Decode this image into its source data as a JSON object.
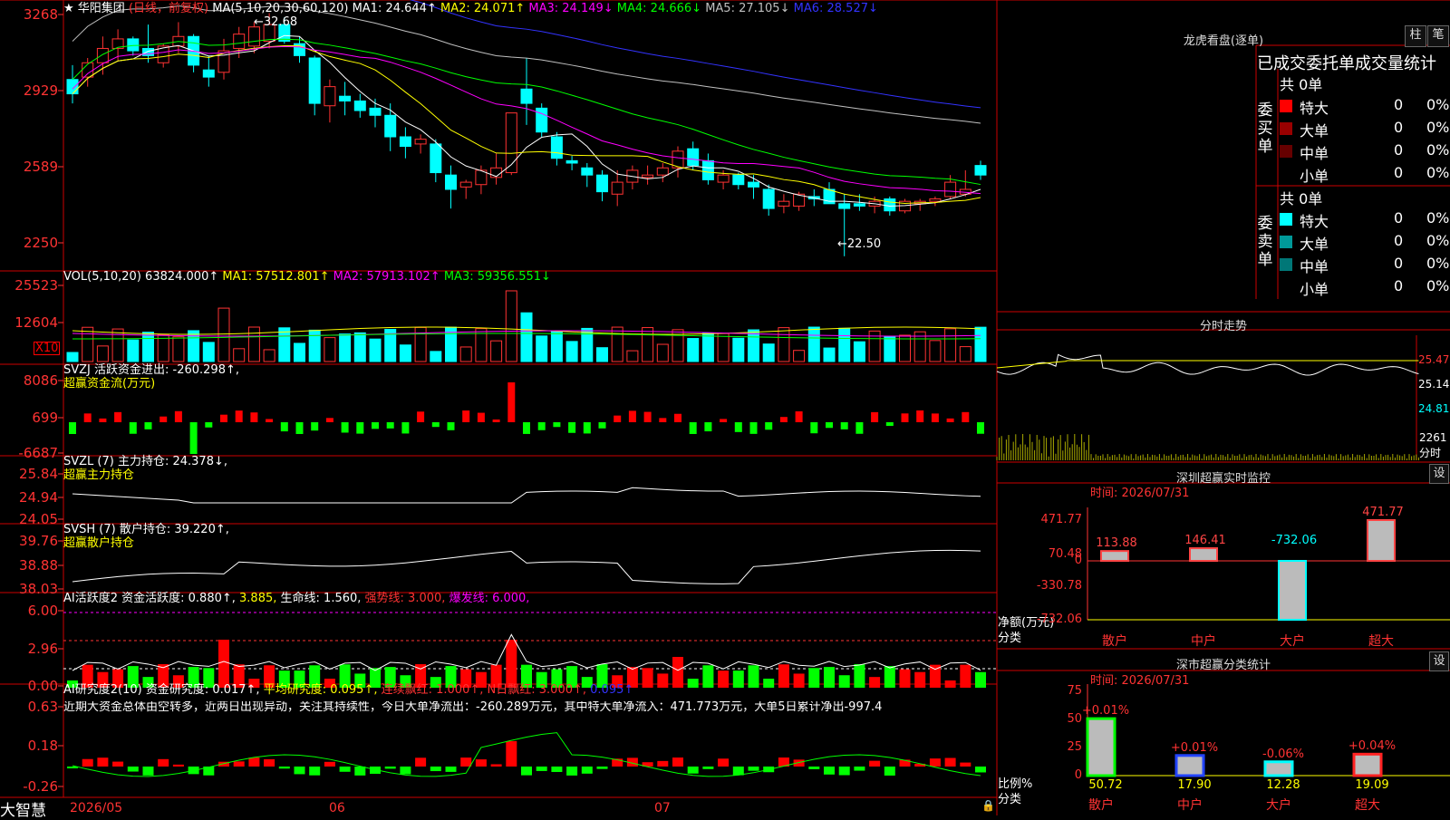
{
  "stock": {
    "name": "华阳集团",
    "mode": "(日线，前复权)",
    "star": "★"
  },
  "main_legend": {
    "ma_params": "MA(5,10,20,30,60,120)",
    "items": [
      {
        "label": "MA1: 24.644↑",
        "color": "#ffffff"
      },
      {
        "label": "MA2: 24.071↑",
        "color": "#ffff00"
      },
      {
        "label": "MA3: 24.149↓",
        "color": "#ff00ff"
      },
      {
        "label": "MA4: 24.666↓",
        "color": "#00ff00"
      },
      {
        "label": "MA5: 27.105↓",
        "color": "#c0c0c0"
      },
      {
        "label": "MA6: 28.527↓",
        "color": "#3333ff"
      }
    ]
  },
  "price_axis": [
    "3268",
    "2929",
    "2589",
    "2250"
  ],
  "price_annotations": {
    "high": "←32.68",
    "low": "←22.50"
  },
  "vol_panel": {
    "title": "VOL(5,10,20)",
    "value": "63824.000↑",
    "items": [
      {
        "label": "MA1: 57512.801↑",
        "color": "#ffff00"
      },
      {
        "label": "MA2: 57913.102↑",
        "color": "#ff00ff"
      },
      {
        "label": "MA3: 59356.551↓",
        "color": "#00ff00"
      }
    ],
    "axis": [
      "25523",
      "12604"
    ],
    "unit": "X10"
  },
  "svzj_panel": {
    "title": "SVZJ  活跃资金进出: -260.298↑,",
    "subtitle": "超赢资金流(万元)",
    "axis": [
      "8086",
      "699",
      "-6687"
    ]
  },
  "svzl_panel": {
    "title": "SVZL (7) 主力持仓: 24.378↓,",
    "subtitle": "超赢主力持仓",
    "axis": [
      "25.84",
      "24.94",
      "24.05"
    ]
  },
  "svsh_panel": {
    "title": "SVSH (7) 散户持仓: 39.220↑,",
    "subtitle": "超赢散户持仓",
    "axis": [
      "39.76",
      "38.88",
      "38.03"
    ]
  },
  "ai_active_panel": {
    "title_a": "AI活跃度2 资金活跃度: 0.880↑,",
    "title_b": "3.885,",
    "title_c": "生命线: 1.560,",
    "title_d": "强势线: 3.000,",
    "title_e": "爆发线: 6.000,",
    "axis": [
      "6.00",
      "2.96",
      "0.00"
    ]
  },
  "ai_research_panel": {
    "title_a": "AI研究度2(10) 资金研究度: 0.017↑,",
    "title_b": "平均研究度: 0.095↑,",
    "title_c": "连续飘红: 1.000↑,",
    "title_d": "N日飘红: 3.000↑,",
    "title_e": "0.095↑",
    "comment": "近期大资金总体由空转多，近两日出现异动，关注其持续性，今日大单净流出：-260.289万元，其中特大单净流入：471.773万元，大单5日累计净出-997.4",
    "axis": [
      "0.63",
      "0.18",
      "-0.26"
    ]
  },
  "date_axis": {
    "labels": [
      "2026/05",
      "06",
      "07"
    ],
    "brand": "大智慧"
  },
  "right_top": {
    "title": "龙虎看盘(逐单)",
    "btn_a": "柱",
    "btn_b": "笔",
    "tabs": "已成交委托单成交量统计",
    "buy": {
      "side": "委买单",
      "total": "共 0单",
      "rows": [
        {
          "label": "特大",
          "count": "0",
          "pct": "0%",
          "color": "#ff0000"
        },
        {
          "label": "大单",
          "count": "0",
          "pct": "0%",
          "color": "#990000"
        },
        {
          "label": "中单",
          "count": "0",
          "pct": "0%",
          "color": "#660000"
        },
        {
          "label": "小单",
          "count": "0",
          "pct": "0%",
          "color": "#000000"
        }
      ]
    },
    "sell": {
      "side": "委卖单",
      "total": "共 0单",
      "rows": [
        {
          "label": "特大",
          "count": "0",
          "pct": "0%",
          "color": "#00ffff"
        },
        {
          "label": "大单",
          "count": "0",
          "pct": "0%",
          "color": "#009999"
        },
        {
          "label": "中单",
          "count": "0",
          "pct": "0%",
          "color": "#007777"
        },
        {
          "label": "小单",
          "count": "0",
          "pct": "0%",
          "color": "#000000"
        }
      ]
    }
  },
  "intraday": {
    "title": "分时走势",
    "axis": [
      "25.47",
      "25.14",
      "24.81"
    ],
    "vol_label": "2261",
    "unit": "分时"
  },
  "monitor": {
    "title": "深圳超赢实时监控",
    "btn": "设",
    "time": "时间: 2026/07/31",
    "axis": [
      "471.77",
      "70.48",
      "0",
      "-330.78",
      "-732.06"
    ],
    "ylabel": "净额(万元)",
    "xlabel": "分类",
    "bars": [
      {
        "cat": "散户",
        "value": 113.88,
        "label": "113.88"
      },
      {
        "cat": "中户",
        "value": 146.41,
        "label": "146.41"
      },
      {
        "cat": "大户",
        "value": -732.06,
        "label": "-732.06"
      },
      {
        "cat": "超大",
        "value": 471.77,
        "label": "471.77"
      }
    ]
  },
  "classify": {
    "title": "深市超赢分类统计",
    "btn": "设",
    "time": "时间: 2026/07/31",
    "axis": [
      "75",
      "50",
      "25",
      "0"
    ],
    "ylabel": "比例%",
    "xlabel": "分类",
    "bars": [
      {
        "cat": "散户",
        "value": 50.72,
        "label": "50.72",
        "delta": "+0.01%",
        "color": "#00ff00"
      },
      {
        "cat": "中户",
        "value": 17.9,
        "label": "17.90",
        "delta": "+0.01%",
        "color": "#2244ff"
      },
      {
        "cat": "大户",
        "value": 12.28,
        "label": "12.28",
        "delta": "-0.06%",
        "color": "#00ffff"
      },
      {
        "cat": "超大",
        "value": 19.09,
        "label": "19.09",
        "delta": "+0.04%",
        "color": "#ff2222"
      }
    ]
  },
  "chart_data": {
    "type": "bar",
    "candles": [
      [
        29.9,
        30.5,
        28.9,
        29.3
      ],
      [
        30.0,
        30.8,
        29.6,
        30.6
      ],
      [
        30.6,
        31.7,
        30.1,
        31.2
      ],
      [
        31.2,
        32.0,
        30.7,
        31.6
      ],
      [
        31.6,
        31.7,
        30.9,
        31.1
      ],
      [
        31.2,
        32.2,
        30.6,
        30.9
      ],
      [
        30.6,
        31.4,
        30.4,
        31.3
      ],
      [
        31.3,
        32.3,
        31.0,
        31.7
      ],
      [
        31.7,
        31.8,
        30.2,
        30.5
      ],
      [
        30.3,
        30.9,
        29.6,
        30.0
      ],
      [
        30.2,
        31.6,
        29.9,
        31.1
      ],
      [
        31.2,
        32.1,
        30.8,
        31.8
      ],
      [
        31.3,
        32.3,
        31.0,
        32.1
      ],
      [
        31.5,
        32.68,
        31.2,
        32.2
      ],
      [
        32.2,
        32.5,
        31.4,
        31.5
      ],
      [
        31.4,
        31.7,
        30.6,
        30.9
      ],
      [
        30.8,
        30.9,
        28.4,
        28.9
      ],
      [
        28.8,
        29.9,
        28.1,
        29.6
      ],
      [
        29.2,
        29.8,
        28.4,
        29.0
      ],
      [
        29.0,
        29.3,
        28.3,
        28.6
      ],
      [
        28.7,
        29.1,
        27.9,
        28.4
      ],
      [
        28.4,
        28.9,
        26.9,
        27.5
      ],
      [
        27.5,
        27.9,
        26.6,
        27.1
      ],
      [
        27.2,
        27.6,
        26.8,
        27.4
      ],
      [
        27.2,
        27.4,
        25.6,
        26.0
      ],
      [
        25.9,
        26.3,
        24.5,
        25.3
      ],
      [
        25.4,
        25.7,
        24.9,
        25.6
      ],
      [
        25.5,
        26.3,
        25.1,
        26.1
      ],
      [
        25.8,
        26.8,
        25.5,
        26.2
      ],
      [
        26.0,
        28.5,
        25.9,
        28.5
      ],
      [
        29.5,
        30.8,
        28.0,
        28.9
      ],
      [
        28.7,
        28.9,
        27.5,
        27.7
      ],
      [
        27.5,
        27.7,
        26.3,
        26.6
      ],
      [
        26.5,
        26.7,
        26.1,
        26.4
      ],
      [
        26.2,
        26.4,
        25.4,
        25.9
      ],
      [
        25.9,
        26.1,
        24.8,
        25.2
      ],
      [
        25.1,
        26.1,
        24.6,
        25.6
      ],
      [
        25.6,
        26.3,
        25.3,
        26.1
      ],
      [
        25.8,
        26.3,
        25.5,
        25.9
      ],
      [
        25.9,
        26.4,
        25.6,
        26.2
      ],
      [
        26.2,
        27.1,
        25.8,
        26.9
      ],
      [
        27.0,
        27.3,
        26.1,
        26.3
      ],
      [
        26.5,
        26.8,
        25.5,
        25.7
      ],
      [
        25.6,
        26.1,
        25.3,
        25.9
      ],
      [
        25.9,
        26.0,
        25.3,
        25.5
      ],
      [
        25.6,
        25.9,
        24.9,
        25.4
      ],
      [
        25.3,
        25.5,
        24.2,
        24.5
      ],
      [
        24.6,
        25.1,
        24.3,
        24.8
      ],
      [
        24.6,
        25.2,
        24.4,
        25.1
      ],
      [
        25.0,
        25.3,
        24.6,
        24.9
      ],
      [
        25.3,
        25.6,
        24.8,
        24.7
      ],
      [
        24.7,
        25.1,
        22.5,
        24.5
      ],
      [
        24.7,
        25.1,
        24.4,
        24.6
      ],
      [
        24.6,
        25.0,
        24.3,
        24.8
      ],
      [
        24.9,
        25.0,
        24.2,
        24.4
      ],
      [
        24.4,
        24.9,
        24.3,
        24.8
      ],
      [
        24.7,
        24.9,
        24.4,
        24.8
      ],
      [
        24.8,
        25.0,
        24.6,
        24.9
      ],
      [
        25.0,
        25.9,
        24.9,
        25.6
      ],
      [
        25.1,
        26.1,
        25.0,
        25.3
      ],
      [
        26.3,
        26.5,
        25.7,
        25.9
      ]
    ],
    "price_range": [
      22.0,
      33.0
    ]
  }
}
